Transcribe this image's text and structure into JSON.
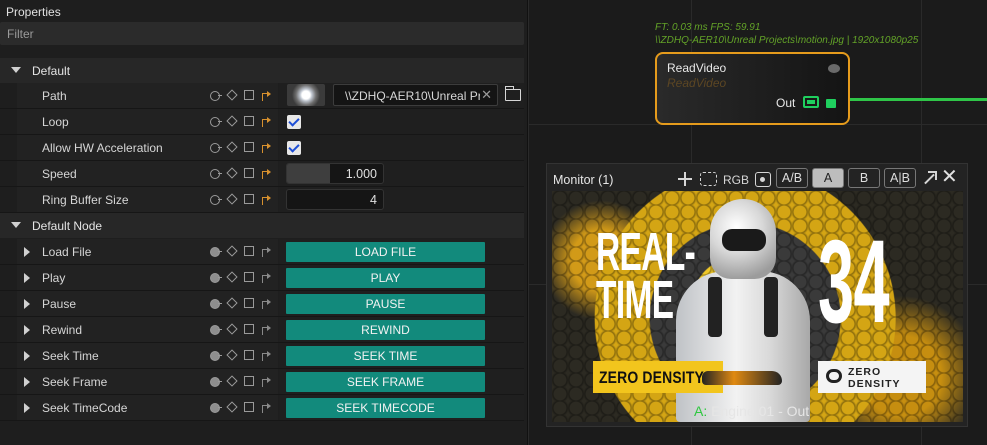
{
  "properties": {
    "title": "Properties",
    "filter_placeholder": "Filter",
    "sections": [
      {
        "label": "Default",
        "rows": [
          {
            "label": "Path",
            "value": "\\\\ZDHQ-AER10\\Unreal Projects\\motion.jpg"
          },
          {
            "label": "Loop",
            "checked": true
          },
          {
            "label": "Allow HW Acceleration",
            "checked": true
          },
          {
            "label": "Speed",
            "value": "1.000"
          },
          {
            "label": "Ring Buffer Size",
            "value": "4"
          }
        ]
      },
      {
        "label": "Default Node",
        "rows": [
          {
            "label": "Load File",
            "button": "LOAD FILE"
          },
          {
            "label": "Play",
            "button": "PLAY"
          },
          {
            "label": "Pause",
            "button": "PAUSE"
          },
          {
            "label": "Rewind",
            "button": "REWIND"
          },
          {
            "label": "Seek Time",
            "button": "SEEK TIME"
          },
          {
            "label": "Seek Frame",
            "button": "SEEK FRAME"
          },
          {
            "label": "Seek TimeCode",
            "button": "SEEK TIMECODE"
          }
        ]
      }
    ]
  },
  "graph": {
    "stats_line1": "FT: 0.03 ms FPS: 59.91",
    "stats_line2": "\\\\ZDHQ-AER10\\Unreal Projects\\motion.jpg | 1920x1080p25",
    "node": {
      "title": "ReadVideo",
      "subtitle": "ReadVideo",
      "output_label": "Out"
    }
  },
  "monitor": {
    "title": "Monitor (1)",
    "channel_label": "RGB",
    "buttons": [
      "A/B",
      "A",
      "B",
      "A|B"
    ],
    "selected_button": "A",
    "footer_prefix": "A:",
    "footer_text": "Engine 01 - Out",
    "video": {
      "headline": "REAL-\nTIME",
      "number": "34",
      "sponsor_yellow": "ZERO DENSITY",
      "sponsor_white_line1": "ZERO",
      "sponsor_white_line2": "DENSITY"
    }
  },
  "colors": {
    "accent_teal": "#128a7c",
    "node_border": "#e59b1c",
    "wire_green": "#2fc548",
    "stats_green": "#63a328"
  }
}
